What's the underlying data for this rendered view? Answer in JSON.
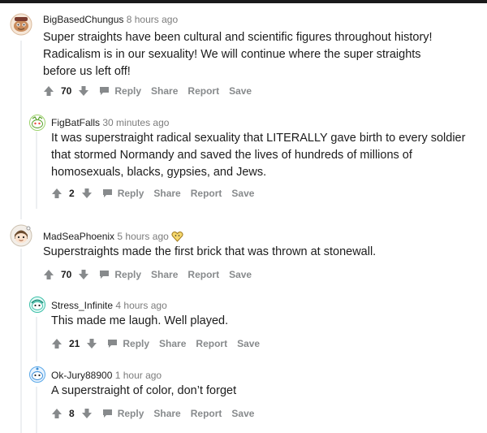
{
  "comments": [
    {
      "author": "BigBasedChungus",
      "time": "8 hours ago",
      "text": "Super straights have been cultural and scientific figures throughout history! Radicalism is in our sexuality! We will continue where the super straights before us left off!",
      "score": "70",
      "actions": {
        "reply": "Reply",
        "share": "Share",
        "report": "Report",
        "save": "Save"
      }
    },
    {
      "author": "FigBatFalls",
      "time": "30 minutes ago",
      "text": "It was superstraight radical sexuality that LITERALLY gave birth to every soldier that stormed Normandy and saved the lives of hundreds of millions of homosexuals, blacks, gypsies, and Jews.",
      "score": "2",
      "actions": {
        "reply": "Reply",
        "share": "Share",
        "report": "Report",
        "save": "Save"
      }
    },
    {
      "author": "MadSeaPhoenix",
      "time": "5 hours ago",
      "text": "Superstraights made the first brick that was thrown at stonewall.",
      "score": "70",
      "actions": {
        "reply": "Reply",
        "share": "Share",
        "report": "Report",
        "save": "Save"
      }
    },
    {
      "author": "Stress_Infinite",
      "time": "4 hours ago",
      "text": "This made me laugh. Well played.",
      "score": "21",
      "actions": {
        "reply": "Reply",
        "share": "Share",
        "report": "Report",
        "save": "Save"
      }
    },
    {
      "author": "Ok-Jury88900",
      "time": "1 hour ago",
      "text": "A superstraight of color, don’t forget",
      "score": "8",
      "actions": {
        "reply": "Reply",
        "share": "Share",
        "report": "Report",
        "save": "Save"
      }
    }
  ],
  "colors": {
    "accent": "#0079d3",
    "muted": "#878a8c",
    "thread": "#edeff1"
  }
}
